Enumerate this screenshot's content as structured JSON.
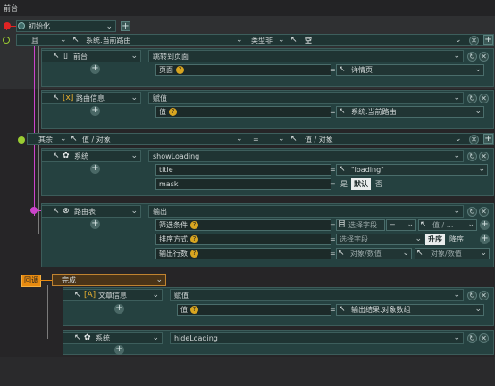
{
  "title": "前台",
  "init": {
    "label": "初始化"
  },
  "branch_if": {
    "op": "且",
    "left": "系统.当前路由",
    "cmp": "类型非",
    "right": "空"
  },
  "nav": {
    "target": "前台",
    "action": "跳转到页面",
    "param_label": "页面",
    "eq": "=",
    "param_value": "详情页"
  },
  "route_info": {
    "target": "路由信息",
    "action": "赋值",
    "param_label": "值",
    "eq": "=",
    "param_value": "系统.当前路由"
  },
  "branch_else": {
    "op": "其余",
    "left": "值 / 对象",
    "cmp": "=",
    "right": "值 / 对象"
  },
  "show_loading": {
    "target": "系统",
    "action": "showLoading",
    "title_label": "title",
    "title_value": "\"loading\"",
    "mask_label": "mask",
    "eq": "=",
    "mask_yes": "是",
    "mask_default": "默认",
    "mask_no": "否"
  },
  "route_table": {
    "target": "路由表",
    "action": "输出",
    "filter_label": "筛选条件",
    "filter_field": "选择字段",
    "filter_eq": "=",
    "filter_value": "值 / ...",
    "sort_label": "排序方式",
    "sort_field": "选择字段",
    "sort_asc": "升序",
    "sort_desc": "降序",
    "rows_label": "输出行数",
    "rows_a": "对象/数值",
    "rows_b": "对象/数值",
    "eq": "="
  },
  "callback": {
    "badge": "回调",
    "label": "完成"
  },
  "article": {
    "target": "文章信息",
    "action": "赋值",
    "param_label": "值",
    "eq": "=",
    "param_value": "输出结果.对象数组"
  },
  "hide_loading": {
    "target": "系统",
    "action": "hideLoading"
  },
  "colors": {
    "red": "#e02424",
    "green": "#9acd32",
    "purple": "#cc44cc",
    "orange": "#e88b10",
    "block": "#254140"
  }
}
